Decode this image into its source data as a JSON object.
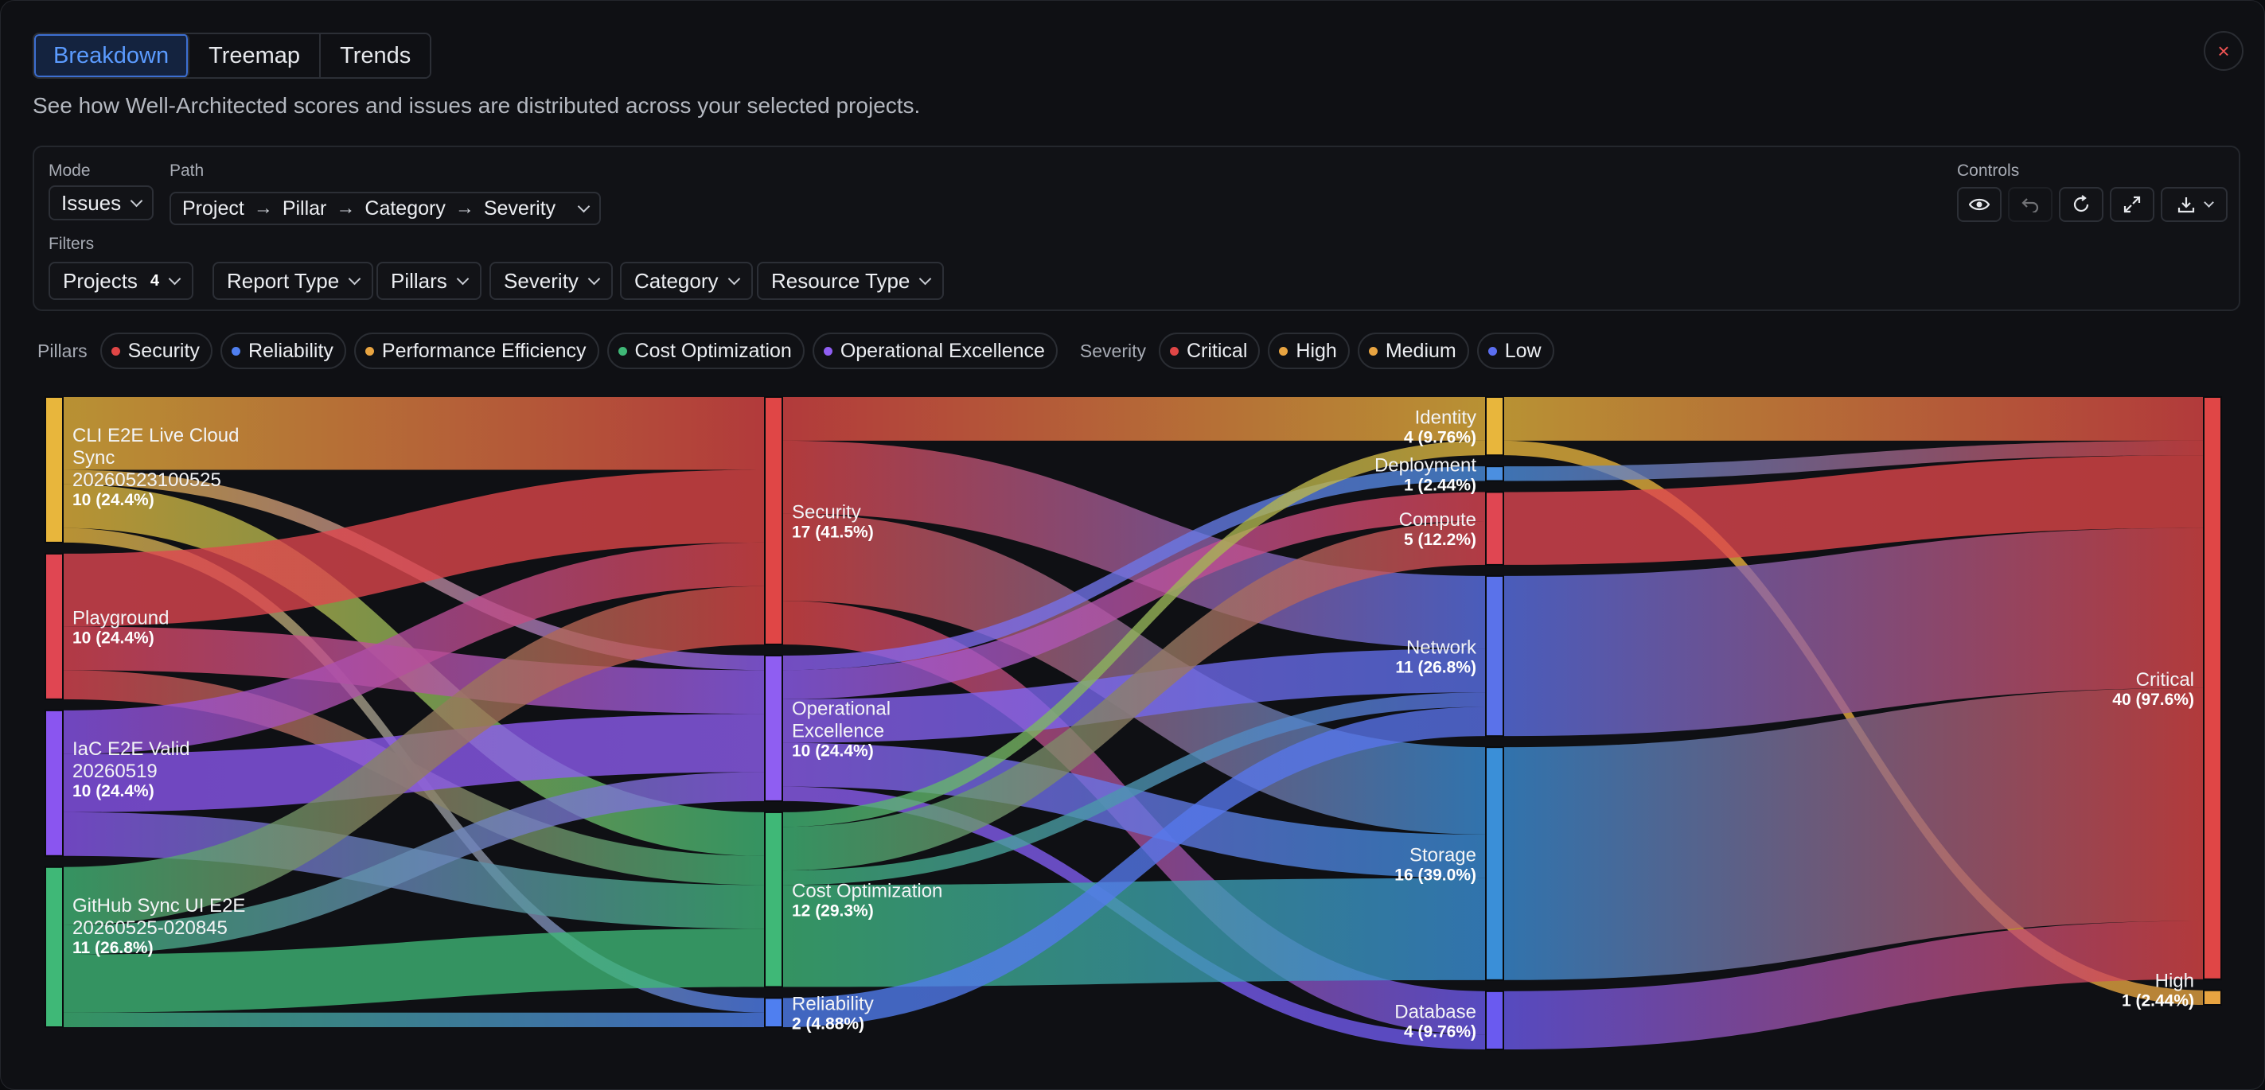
{
  "tabs": [
    {
      "label": "Breakdown",
      "active": true
    },
    {
      "label": "Treemap",
      "active": false
    },
    {
      "label": "Trends",
      "active": false
    }
  ],
  "close_label": "×",
  "subtitle": "See how Well-Architected scores and issues are distributed across your selected projects.",
  "controls": {
    "mode_label": "Mode",
    "mode_value": "Issues",
    "path_label": "Path",
    "path": [
      "Project",
      "Pillar",
      "Category",
      "Severity"
    ],
    "controls_label": "Controls",
    "icons": [
      "eye-icon",
      "undo-icon",
      "reset-icon",
      "expand-icon",
      "download-icon"
    ]
  },
  "filters": {
    "label": "Filters",
    "projects_label": "Projects",
    "projects_count": "4",
    "report_type": "Report Type",
    "pillars": "Pillars",
    "severity": "Severity",
    "category": "Category",
    "resource_type": "Resource Type"
  },
  "legend": {
    "pillars_title": "Pillars",
    "pillars": [
      {
        "label": "Security",
        "color": "#e04646"
      },
      {
        "label": "Reliability",
        "color": "#4f7ff0"
      },
      {
        "label": "Performance Efficiency",
        "color": "#e8a441"
      },
      {
        "label": "Cost Optimization",
        "color": "#3fb877"
      },
      {
        "label": "Operational Excellence",
        "color": "#8f5ef2"
      }
    ],
    "severity_title": "Severity",
    "severity": [
      {
        "label": "Critical",
        "color": "#e04646"
      },
      {
        "label": "High",
        "color": "#e8a441"
      },
      {
        "label": "Medium",
        "color": "#e8a441"
      },
      {
        "label": "Low",
        "color": "#5b6ef0"
      }
    ]
  },
  "chart_data": {
    "type": "sankey",
    "levels": [
      "Project",
      "Pillar",
      "Category",
      "Severity"
    ],
    "nodes": [
      {
        "id": "cli",
        "level": 0,
        "label": [
          "CLI E2E Live Cloud",
          "Sync",
          "20260523100525"
        ],
        "value_label": "10 (24.4%)",
        "value": 10,
        "color": "#e8b63c"
      },
      {
        "id": "play",
        "level": 0,
        "label": [
          "Playground"
        ],
        "value_label": "10 (24.4%)",
        "value": 10,
        "color": "#e04652"
      },
      {
        "id": "iac",
        "level": 0,
        "label": [
          "IaC E2E Valid",
          "20260519"
        ],
        "value_label": "10 (24.4%)",
        "value": 10,
        "color": "#8a55f0"
      },
      {
        "id": "gh",
        "level": 0,
        "label": [
          "GitHub Sync UI E2E",
          "20260525-020845"
        ],
        "value_label": "11 (26.8%)",
        "value": 11,
        "color": "#3fb877"
      },
      {
        "id": "sec",
        "level": 1,
        "label": [
          "Security"
        ],
        "value_label": "17 (41.5%)",
        "value": 17,
        "color": "#e04646"
      },
      {
        "id": "ops",
        "level": 1,
        "label": [
          "Operational",
          "Excellence"
        ],
        "value_label": "10 (24.4%)",
        "value": 10,
        "color": "#8f5ef2"
      },
      {
        "id": "cost",
        "level": 1,
        "label": [
          "Cost Optimization"
        ],
        "value_label": "12 (29.3%)",
        "value": 12,
        "color": "#3fb877"
      },
      {
        "id": "rel",
        "level": 1,
        "label": [
          "Reliability"
        ],
        "value_label": "2 (4.88%)",
        "value": 2,
        "color": "#4f7ff0"
      },
      {
        "id": "ident",
        "level": 2,
        "label": [
          "Identity"
        ],
        "value_label": "4 (9.76%)",
        "value": 4,
        "color": "#e8b63c"
      },
      {
        "id": "deploy",
        "level": 2,
        "label": [
          "Deployment"
        ],
        "value_label": "1 (2.44%)",
        "value": 1,
        "color": "#4b8fe0"
      },
      {
        "id": "compute",
        "level": 2,
        "label": [
          "Compute"
        ],
        "value_label": "5 (12.2%)",
        "value": 5,
        "color": "#e04652"
      },
      {
        "id": "net",
        "level": 2,
        "label": [
          "Network"
        ],
        "value_label": "11 (26.8%)",
        "value": 11,
        "color": "#5a72ea"
      },
      {
        "id": "stor",
        "level": 2,
        "label": [
          "Storage"
        ],
        "value_label": "16 (39.0%)",
        "value": 16,
        "color": "#3a8fd8"
      },
      {
        "id": "db",
        "level": 2,
        "label": [
          "Database"
        ],
        "value_label": "4 (9.76%)",
        "value": 4,
        "color": "#6a5af0"
      },
      {
        "id": "crit",
        "level": 3,
        "label": [
          "Critical"
        ],
        "value_label": "40 (97.6%)",
        "value": 40,
        "color": "#e04646"
      },
      {
        "id": "high",
        "level": 3,
        "label": [
          "High"
        ],
        "value_label": "1 (2.44%)",
        "value": 1,
        "color": "#e8a441"
      }
    ],
    "links": [
      {
        "source": "cli",
        "target": "sec",
        "value": 5
      },
      {
        "source": "cli",
        "target": "ops",
        "value": 1
      },
      {
        "source": "cli",
        "target": "cost",
        "value": 3
      },
      {
        "source": "cli",
        "target": "rel",
        "value": 1
      },
      {
        "source": "play",
        "target": "sec",
        "value": 5
      },
      {
        "source": "play",
        "target": "ops",
        "value": 3
      },
      {
        "source": "play",
        "target": "cost",
        "value": 2
      },
      {
        "source": "iac",
        "target": "sec",
        "value": 3
      },
      {
        "source": "iac",
        "target": "ops",
        "value": 4
      },
      {
        "source": "iac",
        "target": "cost",
        "value": 3
      },
      {
        "source": "gh",
        "target": "sec",
        "value": 4
      },
      {
        "source": "gh",
        "target": "ops",
        "value": 2
      },
      {
        "source": "gh",
        "target": "cost",
        "value": 4
      },
      {
        "source": "gh",
        "target": "rel",
        "value": 1
      },
      {
        "source": "sec",
        "target": "ident",
        "value": 3
      },
      {
        "source": "sec",
        "target": "net",
        "value": 5
      },
      {
        "source": "sec",
        "target": "stor",
        "value": 6
      },
      {
        "source": "sec",
        "target": "db",
        "value": 3
      },
      {
        "source": "ops",
        "target": "deploy",
        "value": 1
      },
      {
        "source": "ops",
        "target": "compute",
        "value": 2
      },
      {
        "source": "ops",
        "target": "net",
        "value": 3
      },
      {
        "source": "ops",
        "target": "stor",
        "value": 3
      },
      {
        "source": "ops",
        "target": "db",
        "value": 1
      },
      {
        "source": "cost",
        "target": "compute",
        "value": 3
      },
      {
        "source": "cost",
        "target": "net",
        "value": 1
      },
      {
        "source": "cost",
        "target": "stor",
        "value": 7
      },
      {
        "source": "cost",
        "target": "ident",
        "value": 1
      },
      {
        "source": "rel",
        "target": "net",
        "value": 2
      },
      {
        "source": "ident",
        "target": "crit",
        "value": 3
      },
      {
        "source": "ident",
        "target": "high",
        "value": 1
      },
      {
        "source": "deploy",
        "target": "crit",
        "value": 1
      },
      {
        "source": "compute",
        "target": "crit",
        "value": 5
      },
      {
        "source": "net",
        "target": "crit",
        "value": 11
      },
      {
        "source": "stor",
        "target": "crit",
        "value": 16
      },
      {
        "source": "db",
        "target": "crit",
        "value": 4
      }
    ]
  }
}
